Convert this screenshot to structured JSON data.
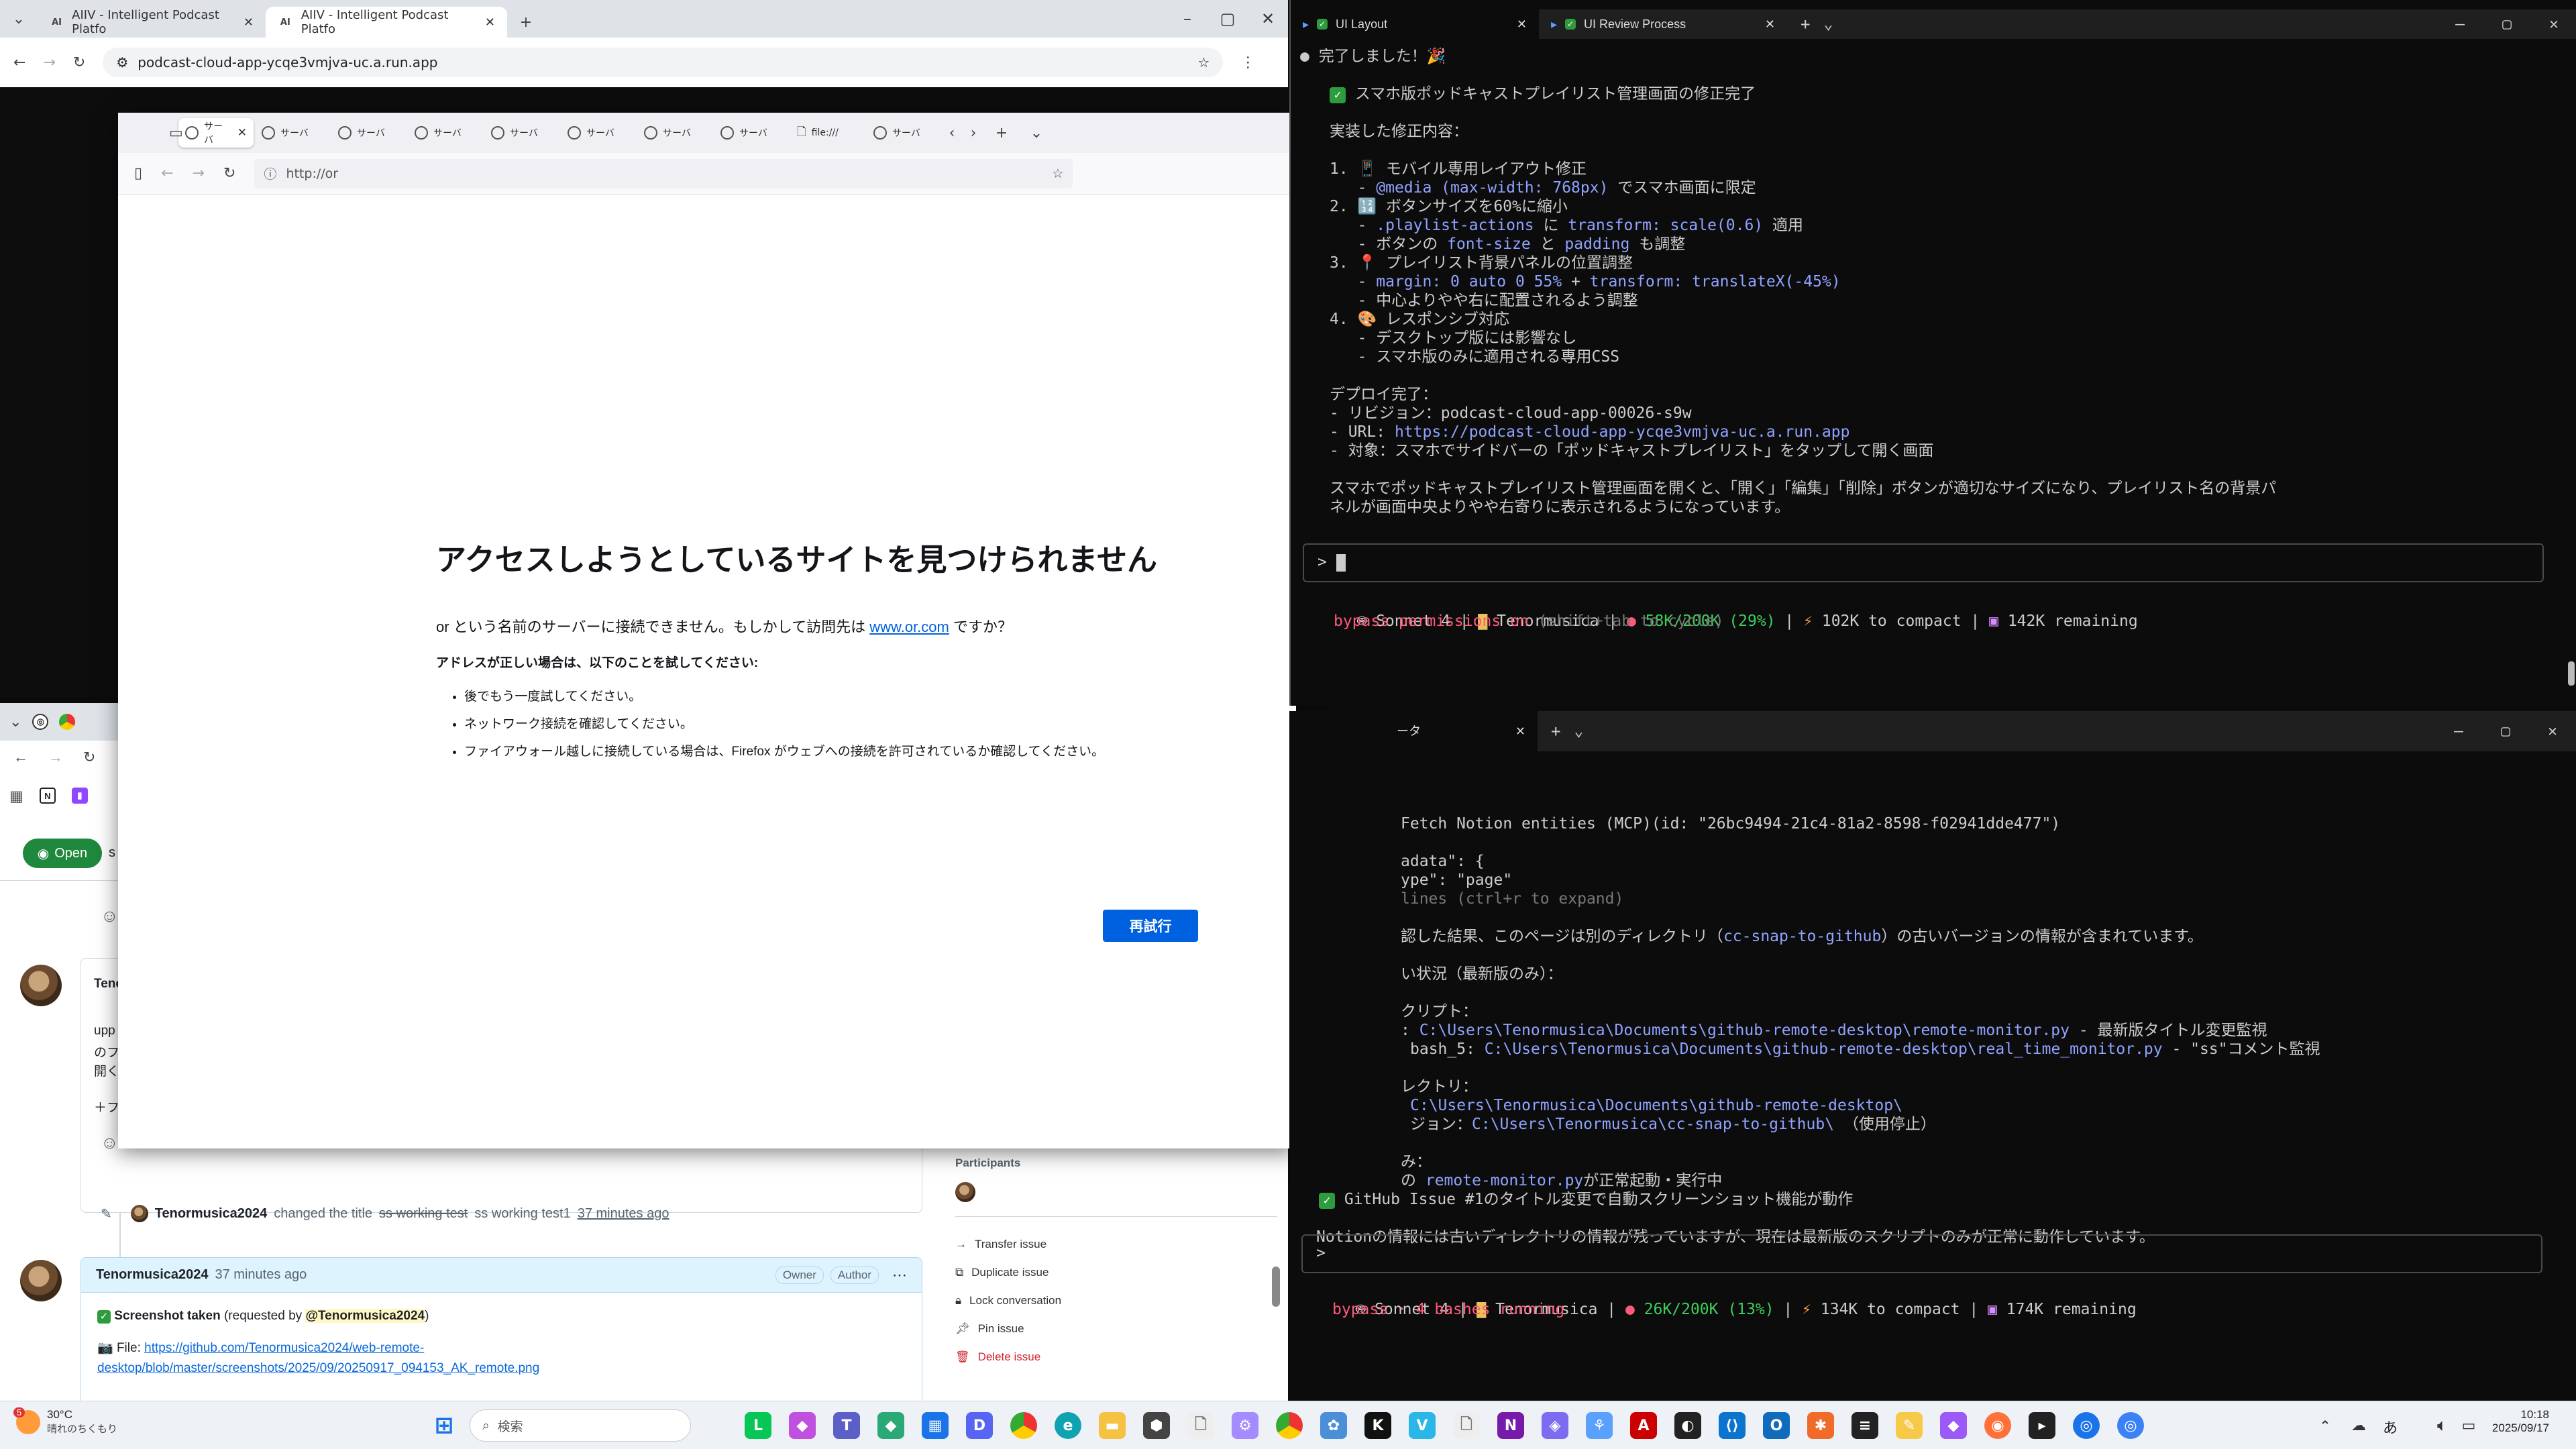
{
  "chrome": {
    "tab1": "AIIV - Intelligent Podcast Platfo",
    "tab2": "AIIV - Intelligent Podcast Platfo",
    "url": "podcast-cloud-app-ycqe3vmjva-uc.a.run.app"
  },
  "firefox": {
    "tabs": [
      "サーバ",
      "サーバ",
      "サーバ",
      "サーバ",
      "サーバ",
      "サーバ",
      "サーバ",
      "サーバ",
      "file:///",
      "サーバ"
    ],
    "url": "http://or",
    "title": "アクセスしようとしているサイトを見つけられません",
    "desc_pre": "or という名前のサーバーに接続できません。もしかして訪問先は",
    "desc_link": "www.or.com",
    "desc_post": "ですか？",
    "subhead": "アドレスが正しい場合は、以下のことを試してください:",
    "bullets": [
      "後でもう一度試してください。",
      "ネットワーク接続を確認してください。",
      "ファイアウォール越しに接続している場合は、Firefox がウェブへの接続を許可されているか確認してください。"
    ],
    "retry": "再試行"
  },
  "term1": {
    "tabs": [
      "UI Layout",
      "UI Review Process"
    ],
    "lines": {
      "l1": "● 完了しました！🎉",
      "l2": "スマホ版ポッドキャストプレイリスト管理画面の修正完了",
      "l3": "実装した修正内容：",
      "l4": "1. 📱 モバイル専用レイアウト修正",
      "l5a": "   - ",
      "l5b": "@media (max-width: 768px)",
      "l5c": " でスマホ画面に限定",
      "l6": "2. 🔢 ボタンサイズを60%に縮小",
      "l7a": "   - ",
      "l7b": ".playlist-actions",
      "l7c": " に ",
      "l7d": "transform: scale(0.6)",
      "l7e": " 適用",
      "l8a": "   - ボタンの ",
      "l8b": "font-size",
      "l8c": " と ",
      "l8d": "padding",
      "l8e": " も調整",
      "l9": "3. 📍 プレイリスト背景パネルの位置調整",
      "l10a": "   - ",
      "l10b": "margin: 0 auto 0 55%",
      "l10c": " + ",
      "l10d": "transform: translateX(-45%)",
      "l11": "   - 中心よりやや右に配置されるよう調整",
      "l12": "4. 🎨 レスポンシブ対応",
      "l13": "   - デスクトップ版には影響なし",
      "l14": "   - スマホ版のみに適用される専用CSS",
      "l15": "デプロイ完了：",
      "l16": "- リビジョン：podcast-cloud-app-00026-s9w",
      "l17a": "- URL: ",
      "l17b": "https://podcast-cloud-app-ycqe3vmjva-uc.a.run.app",
      "l18": "- 対象：スマホでサイドバーの「ポッドキャストプレイリスト」をタップして開く画面",
      "l19": "スマホでポッドキャストプレイリスト管理画面を開くと、「開く」「編集」「削除」ボタンが適切なサイズになり、プレイリスト名の背景パ",
      "l20": "ネルが画面中央よりやや右寄りに表示されるようになっています。"
    },
    "prompt": ">",
    "status": {
      "model": "Sonnet 4",
      "dir": "Tenormusica",
      "ctx": "58K/200K (29%)",
      "compact": "102K to compact",
      "remain": "142K remaining"
    },
    "mode_a": "bypass permissions on",
    "mode_b": " (shift+tab to cycle)"
  },
  "term2": {
    "tab": "ータ",
    "lines": {
      "m1": "Fetch Notion entities (MCP)(id: \"26bc9494-21c4-81a2-8598-f02941dde477\")",
      "m2": "adata\": {",
      "m3": "ype\": \"page\"",
      "m4": "lines (ctrl+r to expand)",
      "m5a": "認した結果、このページは別のディレクトリ（",
      "m5b": "cc-snap-to-github",
      "m5c": "）の古いバージョンの情報が含まれています。",
      "m6": "い状況（最新版のみ）：",
      "m7": "クリプト：",
      "m8a": ": ",
      "m8b": "C:\\Users\\Tenormusica\\Documents\\github-remote-desktop\\remote-monitor.py",
      "m8c": " - 最新版タイトル変更監視",
      "m9a": "bash_5: ",
      "m9b": "C:\\Users\\Tenormusica\\Documents\\github-remote-desktop\\real_time_monitor.py",
      "m9c": " - \"ss\"コメント監視",
      "m10": "レクトリ：",
      "m11": "C:\\Users\\Tenormusica\\Documents\\github-remote-desktop\\",
      "m12a": "ジョン：",
      "m12b": "C:\\Users\\Tenormusica\\cc-snap-to-github\\",
      "m12c": " （使用停止）",
      "m13": "み：",
      "m14a": "の ",
      "m14b": "remote-monitor.py",
      "m14c": "が正常起動・実行中",
      "m15": "GitHub Issue #1のタイトル変更で自動スクリーンショット機能が動作",
      "m16": "Notionの情報には古いディレクトリの情報が残っていますが、現在は最新版のスクリプトのみが正常に動作しています。"
    },
    "prompt": ">",
    "status": {
      "model": "Sonnet 4",
      "dir": "Tenormusica",
      "ctx": "26K/200K (13%)",
      "compact": "134K to compact",
      "remain": "174K remaining"
    },
    "mode_a": "bypass",
    "mode_b": " · 4 bashes running"
  },
  "github": {
    "open": "Open",
    "frag1": "Tenc",
    "frag2": "upp",
    "frag3": "のフ",
    "frag4": "開く",
    "frag5": "＋フ",
    "event_user": "Tenormusica2024",
    "event_text": "changed the title",
    "event_old": "ss working test",
    "event_new": "ss working test1",
    "event_time": "37 minutes ago",
    "comment_user": "Tenormusica2024",
    "comment_time": "37 minutes ago",
    "badge_owner": "Owner",
    "badge_author": "Author",
    "screenshot": "Screenshot taken",
    "requested": "(requested by",
    "mention": "@Tenormusica2024",
    "requested_end": ")",
    "file_label": "File:",
    "file_link1": "https://github.com/Tenormusica2024/web-remote-",
    "file_link2": "desktop/blob/master/screenshots/2025/09/20250917_094153_AK_remote.png",
    "participants": "Participants",
    "actions": [
      "Transfer issue",
      "Duplicate issue",
      "Lock conversation",
      "Pin issue",
      "Delete issue"
    ],
    "frag_s": "s"
  },
  "taskbar": {
    "temp": "30°C",
    "weather": "晴れのちくもり",
    "search": "検索",
    "ime": "あ",
    "time": "10:18",
    "date": "2025/09/17",
    "badge": "5"
  }
}
